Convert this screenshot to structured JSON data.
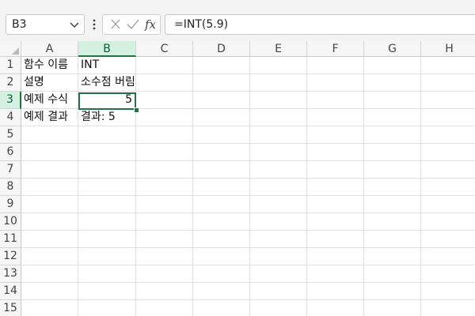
{
  "name_box": {
    "value": "B3",
    "icon": "chevron-down-icon"
  },
  "formula_bar": {
    "menu_icon": "vertical-ellipsis-icon",
    "cancel_icon": "close-icon",
    "enter_icon": "check-icon",
    "fx_label": "fx",
    "formula": "=INT(5.9)"
  },
  "columns": [
    "A",
    "B",
    "C",
    "D",
    "E",
    "F",
    "G",
    "H"
  ],
  "active_column": "B",
  "rows": [
    "1",
    "2",
    "3",
    "4",
    "5",
    "6",
    "7",
    "8",
    "9",
    "10",
    "11",
    "12",
    "13",
    "14",
    "15"
  ],
  "active_row": "3",
  "cells": {
    "A1": "함수 이름",
    "B1": "INT",
    "A2": "설명",
    "B2": "소수점 버림",
    "A3": "예제 수식",
    "B3": "5",
    "A4": "예제 결과",
    "B4": "결과: 5"
  },
  "selected_cell": "B3",
  "colors": {
    "accent": "#217346",
    "header_highlight": "#d3f0e0"
  }
}
